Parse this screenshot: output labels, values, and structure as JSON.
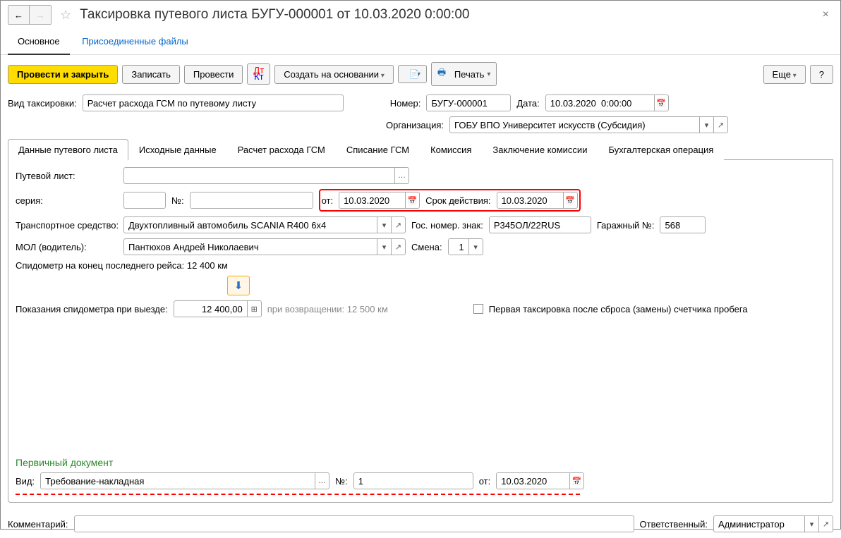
{
  "header": {
    "title": "Таксировка путевого листа БУГУ-000001 от 10.03.2020 0:00:00"
  },
  "nav": {
    "main": "Основное",
    "files": "Присоединенные файлы"
  },
  "toolbar": {
    "post_close": "Провести и закрыть",
    "save": "Записать",
    "post": "Провести",
    "create_based": "Создать на основании",
    "print": "Печать",
    "more": "Еще",
    "help": "?"
  },
  "fields": {
    "type_label": "Вид таксировки:",
    "type_value": "Расчет расхода ГСМ по путевому листу",
    "number_label": "Номер:",
    "number_value": "БУГУ-000001",
    "date_label": "Дата:",
    "date_value": "10.03.2020  0:00:00",
    "org_label": "Организация:",
    "org_value": "ГОБУ ВПО Университет искусств (Субсидия)"
  },
  "tabs": {
    "t1": "Данные путевого листа",
    "t2": "Исходные данные",
    "t3": "Расчет расхода ГСМ",
    "t4": "Списание ГСМ",
    "t5": "Комиссия",
    "t6": "Заключение комиссии",
    "t7": "Бухгалтерская операция"
  },
  "waybill": {
    "list_label": "Путевой лист:",
    "series_label": "серия:",
    "num_label": "№:",
    "from_label": "от:",
    "from_value": "10.03.2020",
    "valid_label": "Срок действия:",
    "valid_value": "10.03.2020",
    "vehicle_label": "Транспортное средство:",
    "vehicle_value": "Двухтопливный автомобиль SCANIA R400 6x4",
    "plate_label": "Гос. номер. знак:",
    "plate_value": "Р345ОЛ/22RUS",
    "garage_label": "Гаражный №:",
    "garage_value": "568",
    "driver_label": "МОЛ (водитель):",
    "driver_value": "Пантюхов Андрей Николаевич",
    "shift_label": "Смена:",
    "shift_value": "1",
    "odo_end_label": "Спидометр на конец последнего рейса: 12 400 км",
    "odo_out_label": "Показания спидометра при выезде:",
    "odo_out_value": "12 400,00",
    "odo_back_label": "при возвращении: 12 500 км",
    "first_tax_label": "Первая таксировка после сброса (замены) счетчика пробега"
  },
  "primary": {
    "title": "Первичный документ",
    "kind_label": "Вид:",
    "kind_value": "Требование-накладная",
    "num_label": "№:",
    "num_value": "1",
    "from_label": "от:",
    "from_value": "10.03.2020"
  },
  "footer": {
    "comment_label": "Комментарий:",
    "responsible_label": "Ответственный:",
    "responsible_value": "Администратор"
  }
}
